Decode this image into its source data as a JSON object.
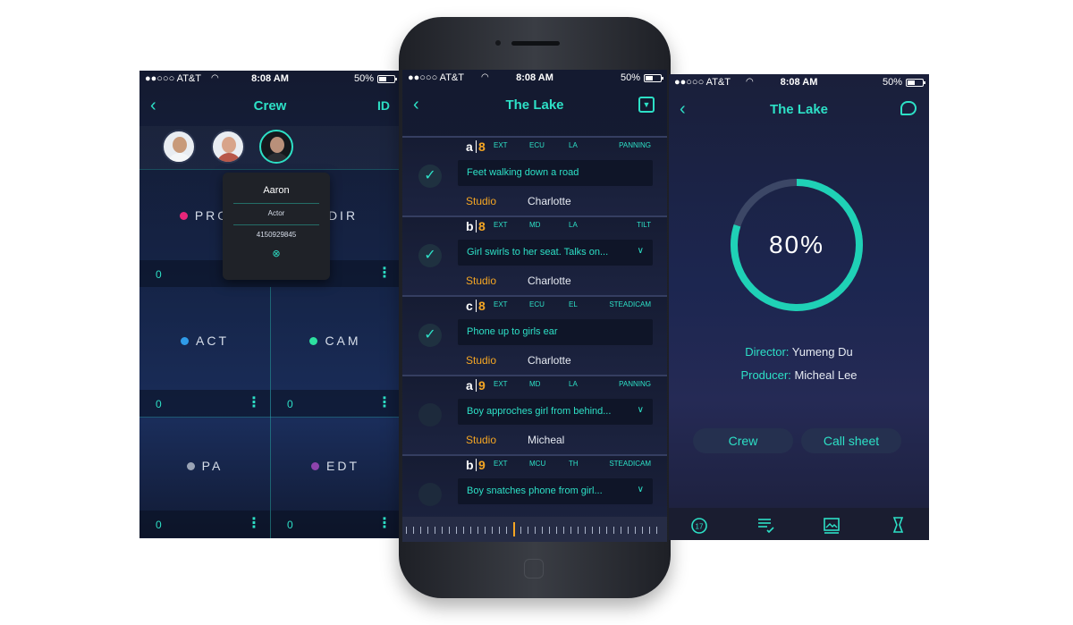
{
  "status": {
    "carrier": "●●○○○ AT&T",
    "time": "8:08 AM",
    "battery": "50%"
  },
  "crew_screen": {
    "title": "Crew",
    "nav_right": "ID",
    "popup": {
      "name": "Aaron",
      "role": "Actor",
      "phone": "4150929845"
    },
    "roles": [
      {
        "code": "PRO",
        "count": "0",
        "color": "#e8267a"
      },
      {
        "code": "DIR",
        "count": "0",
        "color": "#9aa3b5"
      },
      {
        "code": "ACT",
        "count": "0",
        "color": "#2f9be8"
      },
      {
        "code": "CAM",
        "count": "0",
        "color": "#2de0a0"
      },
      {
        "code": "PA",
        "count": "0",
        "color": "#9aa3b5"
      },
      {
        "code": "EDT",
        "count": "0",
        "color": "#8e44ad"
      }
    ]
  },
  "shots_screen": {
    "title": "The Lake",
    "shots": [
      {
        "letter": "a",
        "number": "8",
        "tags": [
          "EXT",
          "ECU",
          "LA",
          "PANNING"
        ],
        "description": "Feet walking down a road",
        "location": "Studio",
        "person": "Charlotte",
        "done": true,
        "expandable": false
      },
      {
        "letter": "b",
        "number": "8",
        "tags": [
          "EXT",
          "MD",
          "LA",
          "TILT"
        ],
        "description": "Girl swirls to her seat. Talks on...",
        "location": "Studio",
        "person": "Charlotte",
        "done": true,
        "expandable": true
      },
      {
        "letter": "c",
        "number": "8",
        "tags": [
          "EXT",
          "ECU",
          "EL",
          "STEADICAM"
        ],
        "description": "Phone up to girls ear",
        "location": "Studio",
        "person": "Charlotte",
        "done": true,
        "expandable": false
      },
      {
        "letter": "a",
        "number": "9",
        "tags": [
          "EXT",
          "MD",
          "LA",
          "PANNING"
        ],
        "description": "Boy approches girl from behind...",
        "location": "Studio",
        "person": "Micheal",
        "done": false,
        "expandable": true
      },
      {
        "letter": "b",
        "number": "9",
        "tags": [
          "EXT",
          "MCU",
          "TH",
          "STEADICAM"
        ],
        "description": "Boy snatches phone from girl...",
        "location": "",
        "person": "",
        "done": false,
        "expandable": true
      }
    ]
  },
  "progress_screen": {
    "title": "The Lake",
    "percent_label": "80%",
    "percent": 0.8,
    "director_label": "Director:",
    "director": "Yumeng Du",
    "producer_label": "Producer:",
    "producer": "Micheal Lee",
    "crew_button": "Crew",
    "callsheet_button": "Call sheet",
    "calendar_day": "17",
    "tabs": [
      "calendar-icon",
      "checklist-icon",
      "image-icon",
      "script-icon"
    ]
  }
}
